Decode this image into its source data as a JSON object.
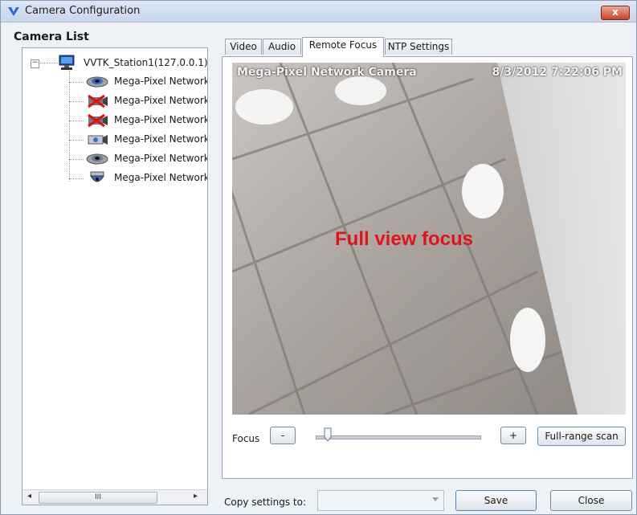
{
  "window": {
    "title": "Camera Configuration",
    "close_glyph": "x"
  },
  "camera_list": {
    "title": "Camera List",
    "root": {
      "label": "VVTK_Station1(127.0.0.1)"
    },
    "items": [
      {
        "label": "Mega-Pixel Network",
        "icon": "dome-camera-icon"
      },
      {
        "label": "Mega-Pixel Network",
        "icon": "camera-disconnected-icon"
      },
      {
        "label": "Mega-Pixel Network",
        "icon": "camera-disconnected-icon"
      },
      {
        "label": "Mega-Pixel Network",
        "icon": "box-camera-icon"
      },
      {
        "label": "Mega-Pixel Network",
        "icon": "dome-camera-icon"
      },
      {
        "label": "Mega-Pixel Network",
        "icon": "speed-dome-camera-icon"
      }
    ],
    "scroll": {
      "left": "◂",
      "right": "▸",
      "thumb": "III"
    }
  },
  "tabs": [
    {
      "label": "Video",
      "active": false
    },
    {
      "label": "Audio",
      "active": false
    },
    {
      "label": "Remote Focus",
      "active": true
    },
    {
      "label": "NTP Settings",
      "active": false
    }
  ],
  "video": {
    "osd_name": "Mega-Pixel Network Camera",
    "osd_time": "8/3/2012 7:22:06 PM",
    "overlay_text": "Full view focus"
  },
  "focus": {
    "label": "Focus",
    "minus_label": "-",
    "plus_label": "+",
    "scan_label": "Full-range scan",
    "slider_value_fraction": 0.04
  },
  "footer": {
    "copy_label": "Copy settings to:",
    "copy_value": "",
    "save_label": "Save",
    "close_label": "Close"
  },
  "colors": {
    "overlay_text": "#e3121a",
    "accent": "#1c6fd1"
  }
}
